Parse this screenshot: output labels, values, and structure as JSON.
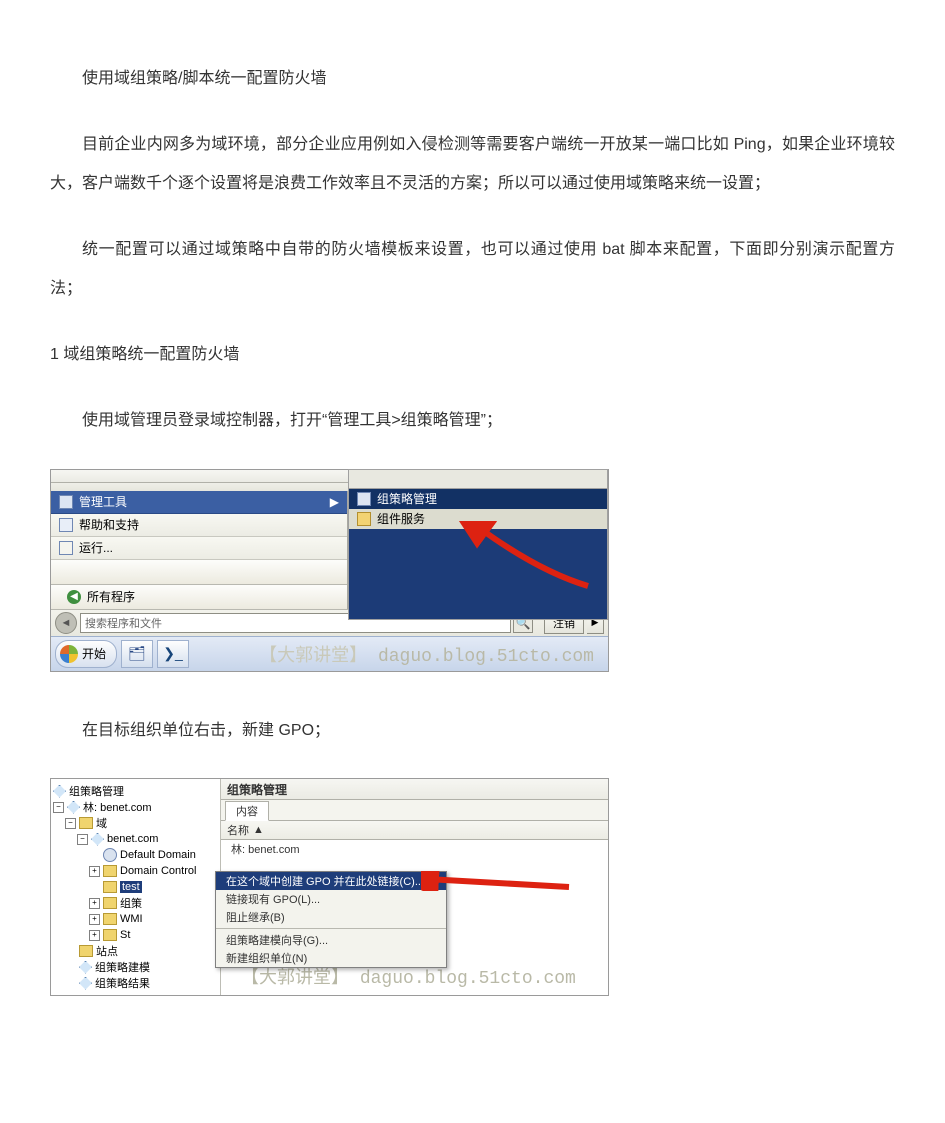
{
  "title": "使用域组策略/脚本统一配置防火墙",
  "para1": "目前企业内网多为域环境，部分企业应用例如入侵检测等需要客户端统一开放某一端口比如 Ping，如果企业环境较大，客户端数千个逐个设置将是浪费工作效率且不灵活的方案；所以可以通过使用域策略来统一设置；",
  "para2": "统一配置可以通过域策略中自带的防火墙模板来设置，也可以通过使用 bat 脚本来配置，下面即分别演示配置方法；",
  "section1": "1 域组策略统一配置防火墙",
  "step1": "使用域管理员登录域控制器，打开“管理工具>组策略管理”；",
  "step2": "在目标组织单位右击，新建 GPO；",
  "shot1": {
    "menu1": "管理工具",
    "menu2": "帮助和支持",
    "menu3": "运行...",
    "sub1": "组策略管理",
    "sub2": "组件服务",
    "all_programs": "所有程序",
    "search_placeholder": "搜索程序和文件",
    "logoff": "注销",
    "start": "开始",
    "watermark_cn": "【大郭讲堂】",
    "watermark_en": "daguo.blog.51cto.com"
  },
  "shot2": {
    "tree_root": "组策略管理",
    "forest": "林: benet.com",
    "domains": "域",
    "domain": "benet.com",
    "default_domain": "Default Domain",
    "domain_control": "Domain Control",
    "test_ou": "test",
    "gpo_folder": "组策",
    "wmi": "WMI",
    "st": "St",
    "sites": "站点",
    "gpo_model": "组策略建模",
    "gpo_result": "组策略结果",
    "main_title": "组策略管理",
    "tab_content": "内容",
    "col_name": "名称",
    "row_forest": "林: benet.com",
    "ctx1": "在这个域中创建 GPO 并在此处链接(C)...",
    "ctx2": "链接现有 GPO(L)...",
    "ctx3": "阻止继承(B)",
    "ctx4": "组策略建模向导(G)...",
    "ctx5": "新建组织单位(N)",
    "watermark_cn": "【大郭讲堂】",
    "watermark_en": "daguo.blog.51cto.com"
  }
}
